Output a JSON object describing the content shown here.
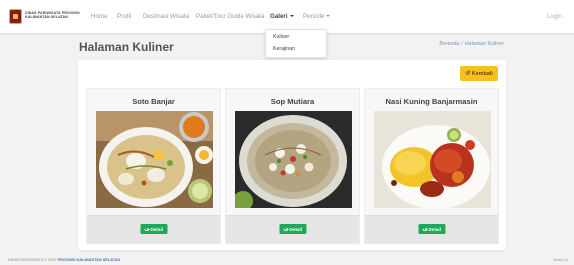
{
  "brand": {
    "line1": "DINAS PARIWISATA PROVINSI",
    "line2": "KALIMANTAN SELATAN"
  },
  "nav": {
    "items": [
      {
        "label": "Home"
      },
      {
        "label": "Profil"
      },
      {
        "label": "Destinasi Wisata"
      },
      {
        "label": "Paket/Tour Guide Wisata"
      },
      {
        "label": "Galeri"
      },
      {
        "label": "Periode"
      }
    ],
    "login": "Login"
  },
  "dropdown": {
    "items": [
      {
        "label": "Kuliner"
      },
      {
        "label": "Kerajinan"
      }
    ]
  },
  "page": {
    "title": "Halaman Kuliner"
  },
  "breadcrumb": {
    "home": "Beranda",
    "separator": "/",
    "current": "Halaman Kuliner"
  },
  "back_button": {
    "label": "Kembali"
  },
  "cards": [
    {
      "title": "Soto Banjar",
      "button": "Detail"
    },
    {
      "title": "Sop Mutiara",
      "button": "Detail"
    },
    {
      "title": "Nasi Kuning Banjarmasin",
      "button": "Detail"
    }
  ],
  "footer": {
    "left": "DINAS PARIWISATA © 2024",
    "left_highlight": "PROVINSI KALIMANTAN SELATAN",
    "right": "Versi 1.0"
  },
  "colors": {
    "accent_yellow": "#f4c21b",
    "detail_green": "#1ea85a",
    "link_blue": "#7a95c4"
  }
}
